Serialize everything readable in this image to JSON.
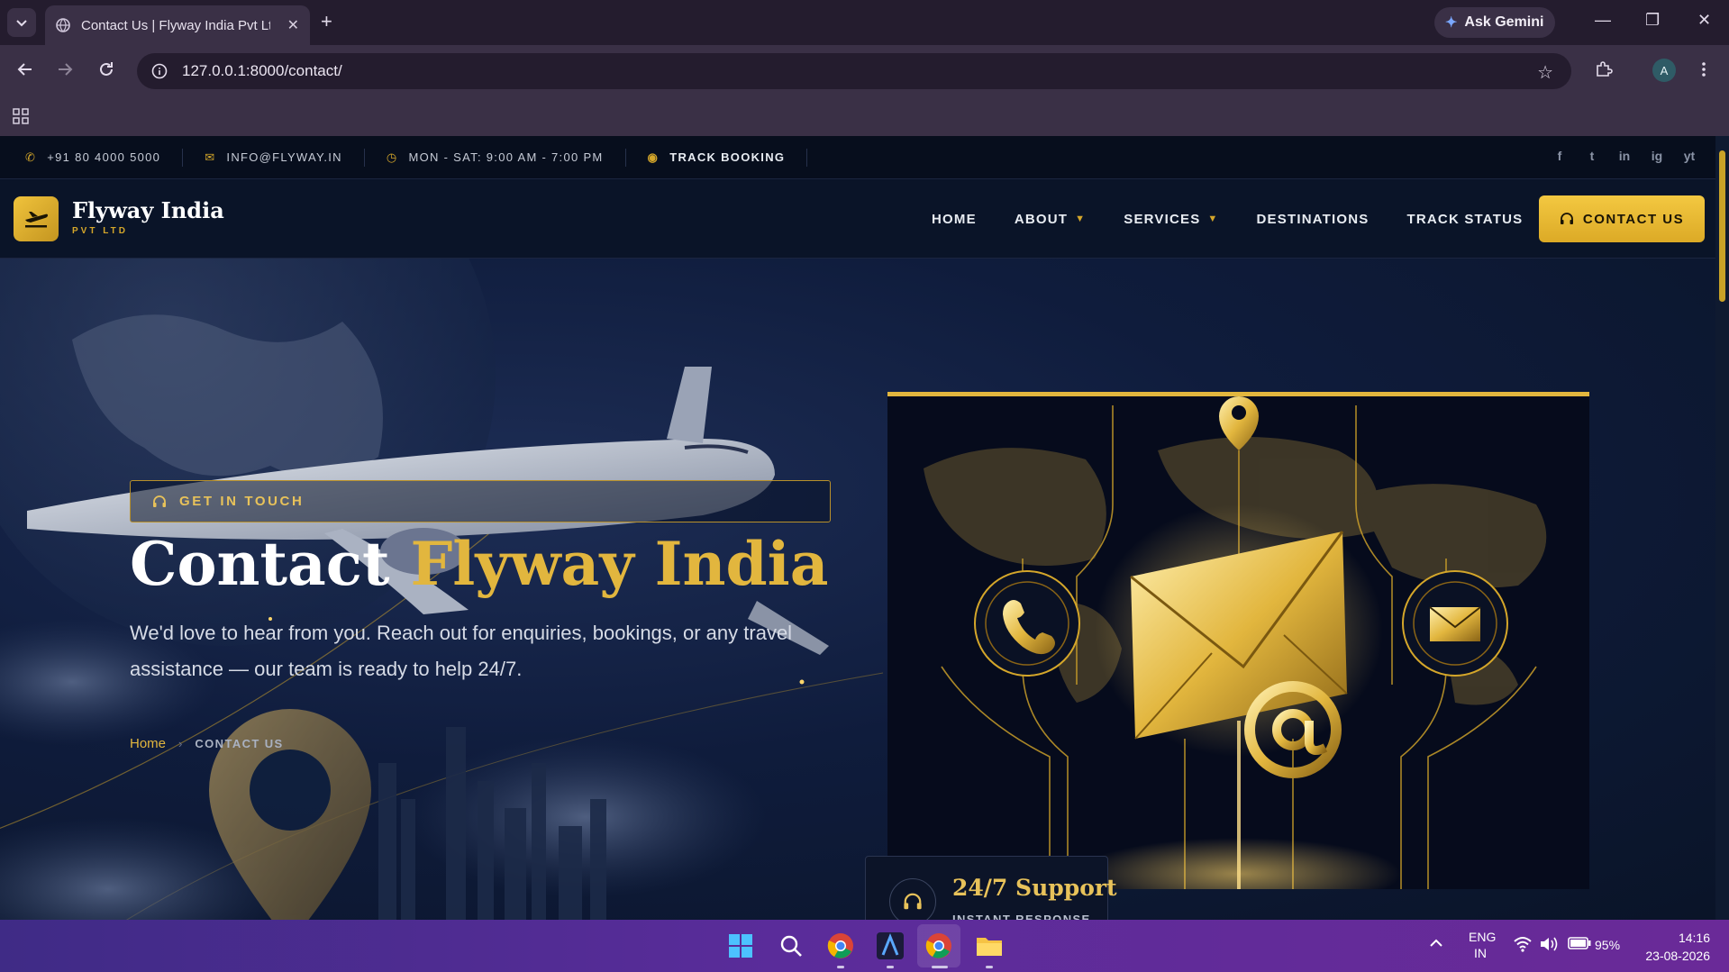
{
  "browser": {
    "tab_title": "Contact Us | Flyway India Pvt Ltd",
    "new_tab_symbol": "+",
    "close_symbol": "✕",
    "ask_gemini": "Ask Gemini",
    "url": "127.0.0.1:8000/contact/",
    "profile_initial": "A",
    "window_controls": [
      "—",
      "❐",
      "✕"
    ]
  },
  "topbar": {
    "phone": "+91 80 4000 5000",
    "email": "INFO@FLYWAY.IN",
    "hours": "MON - SAT: 9:00 AM - 7:00 PM",
    "track": "TRACK BOOKING",
    "socials": [
      "f",
      "t",
      "in",
      "ig",
      "yt"
    ]
  },
  "header": {
    "logo_name": "Flyway India",
    "logo_sub": "PVT LTD",
    "nav": [
      "HOME",
      "ABOUT",
      "SERVICES",
      "DESTINATIONS",
      "TRACK STATUS"
    ],
    "cta": "CONTACT US"
  },
  "hero": {
    "eyebrow": "GET IN TOUCH",
    "title_white": "Contact",
    "title_gold": "Flyway India",
    "description": "We'd love to hear from you. Reach out for enquiries, bookings, or any travel assistance — our team is ready to help 24/7.",
    "breadcrumb_home": "Home",
    "breadcrumb_sep": "›",
    "breadcrumb_current": "CONTACT US",
    "support_title": "24/7 Support",
    "support_sub": "INSTANT RESPONSE"
  },
  "taskbar": {
    "lang_top": "ENG",
    "lang_bottom": "IN",
    "battery": "95%",
    "time": "14:16",
    "date": "23-08-2026"
  },
  "colors": {
    "accent_gold": "#e2b63e",
    "navy": "#0a1428",
    "taskbar": "#5a2c9a"
  }
}
